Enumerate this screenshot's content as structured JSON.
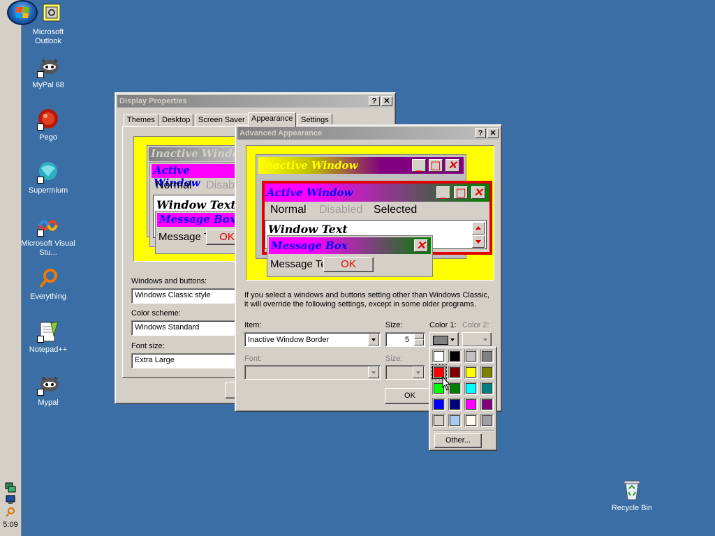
{
  "desktop": {
    "icons": [
      {
        "label": "Microsoft Outlook",
        "icon": "outlook-icon"
      },
      {
        "label": "MyPal 68",
        "icon": "mypal-icon"
      },
      {
        "label": "Pego",
        "icon": "pego-icon"
      },
      {
        "label": "Supermium",
        "icon": "supermium-icon"
      },
      {
        "label": "Microsoft Visual Stu...",
        "icon": "visual-studio-icon"
      },
      {
        "label": "Everything",
        "icon": "everything-icon"
      },
      {
        "label": "Notepad++",
        "icon": "notepadpp-icon"
      },
      {
        "label": "Mypal",
        "icon": "mypal-icon"
      }
    ],
    "recycle_bin": {
      "label": "Recycle Bin",
      "icon": "recycle-bin-icon"
    }
  },
  "taskbar": {
    "clock": "5:09",
    "background": "#d4d0c8"
  },
  "display_props": {
    "title": "Display Properties",
    "tabs": [
      "Themes",
      "Desktop",
      "Screen Saver",
      "Appearance",
      "Settings"
    ],
    "active_tab": "Appearance",
    "preview": {
      "inactive": "Inactive Windo",
      "active": "Active Window",
      "normal": "Normal",
      "disabled": "Disab",
      "window_text": "Window Text",
      "message_box": "Message Box",
      "message_text": "Message T",
      "ok": "OK"
    },
    "windows_buttons_label": "Windows and buttons:",
    "windows_buttons_value": "Windows Classic style",
    "color_scheme_label": "Color scheme:",
    "color_scheme_value": "Windows Standard",
    "font_size_label": "Font size:",
    "font_size_value": "Extra Large"
  },
  "advanced": {
    "title": "Advanced Appearance",
    "preview": {
      "inactive": "Inactive Window",
      "active": "Active Window",
      "normal": "Normal",
      "disabled": "Disabled",
      "selected": "Selected",
      "window_text": "Window Text",
      "message_box": "Message Box",
      "message_text": "Message Te",
      "ok": "OK"
    },
    "info_line1": "If you select a windows and buttons setting other than Windows Classic,",
    "info_line2": "it will override the following settings, except in some older programs.",
    "item_label": "Item:",
    "item_value": "Inactive Window Border",
    "size_label": "Size:",
    "size_value": "5",
    "color1_label": "Color 1:",
    "color2_label": "Color 2:",
    "font_label": "Font:",
    "font_size_label": "Size:",
    "ok": "OK"
  },
  "palette": {
    "colors": [
      "#ffffff",
      "#000000",
      "#c0c0c0",
      "#808080",
      "#ff0000",
      "#800000",
      "#ffff00",
      "#808000",
      "#00ff00",
      "#008000",
      "#00ffff",
      "#008080",
      "#0000ff",
      "#000080",
      "#ff00ff",
      "#800080",
      "#d4d0c8",
      "#a6caf0",
      "#fffbf0",
      "#a0a0a4"
    ],
    "selected_index": 4,
    "other_label": "Other..."
  }
}
